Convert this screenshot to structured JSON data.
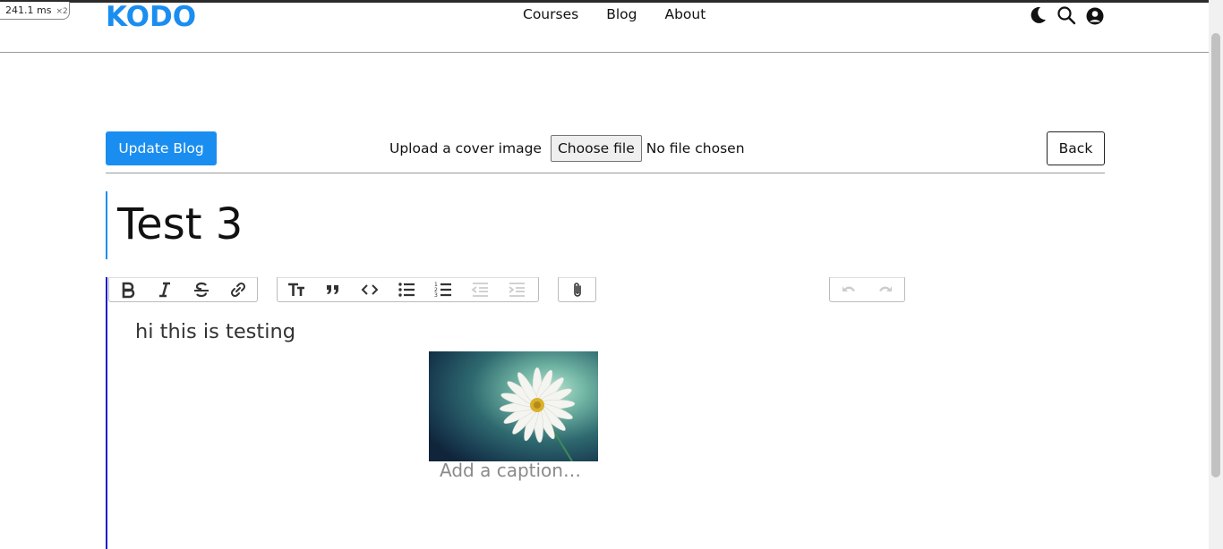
{
  "perf": {
    "time": "241.1 ms",
    "multiplier": "×2"
  },
  "brand": {
    "logo": "KODO",
    "color": "#1a8ef0"
  },
  "nav": {
    "items": [
      "Courses",
      "Blog",
      "About"
    ]
  },
  "header_icons": [
    "moon-icon",
    "search-icon",
    "user-account-icon"
  ],
  "toolbar": {
    "update_label": "Update Blog",
    "upload_label": "Upload a cover image",
    "choose_file_label": "Choose file",
    "no_file_text": "No file chosen",
    "back_label": "Back"
  },
  "post": {
    "title": "Test 3"
  },
  "editor": {
    "toolbar_groups": [
      [
        "bold-icon",
        "italic-icon",
        "strikethrough-icon",
        "link-icon"
      ],
      [
        "heading-icon",
        "quote-icon",
        "code-icon",
        "bullet-list-icon",
        "numbered-list-icon",
        "decrease-indent-icon",
        "increase-indent-icon"
      ],
      [
        "attach-icon"
      ],
      [
        "undo-icon",
        "redo-icon"
      ]
    ],
    "body_text": "hi this is testing",
    "image_alt": "daisy flower image",
    "caption_placeholder": "Add a caption…"
  },
  "colors": {
    "accent": "#1a8ef0",
    "editor_border": "#1818cc"
  }
}
